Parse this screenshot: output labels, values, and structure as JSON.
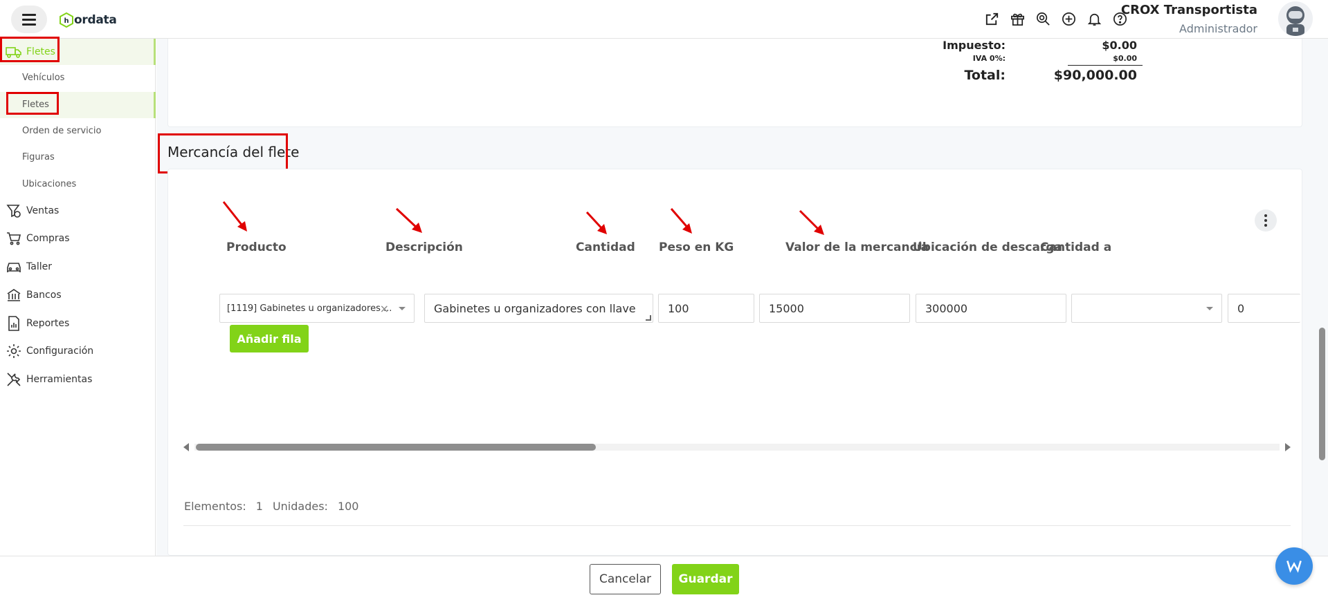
{
  "app": {
    "logo_text": "ordata",
    "logo_letter": "h"
  },
  "header": {
    "user_name": "CROX Transportista",
    "user_role": "Administrador",
    "icons": [
      "external-link-icon",
      "gift-icon",
      "search-icon",
      "plus-circle-icon",
      "bell-icon",
      "help-icon"
    ]
  },
  "sidebar": {
    "fletes_group": "Fletes",
    "sub_items": [
      "Vehículos",
      "Fletes",
      "Orden de servicio",
      "Figuras",
      "Ubicaciones"
    ],
    "items": [
      "Ventas",
      "Compras",
      "Taller",
      "Bancos",
      "Reportes",
      "Configuración",
      "Herramientas"
    ]
  },
  "totals": {
    "impuesto_label": "Impuesto:",
    "impuesto_value": "$0.00",
    "iva_label": "IVA 0%:",
    "iva_value": "$0.00",
    "total_label": "Total:",
    "total_value": "$90,000.00"
  },
  "merchandise": {
    "title": "Mercancía del flete",
    "columns": [
      "Producto",
      "Descripción",
      "Cantidad",
      "Peso en KG",
      "Valor de la mercancía",
      "Ubicación de descarga",
      "Cantidad a"
    ],
    "row": {
      "producto": "[1119] Gabinetes u organizadores ...",
      "descripcion": "Gabinetes u organizadores con llave",
      "cantidad": "100",
      "peso": "15000",
      "valor": "300000",
      "ubicacion": "",
      "cantidad_a": "0"
    },
    "add_row_label": "Añadir fila",
    "summary": {
      "elementos_label": "Elementos:",
      "elementos_value": "1",
      "unidades_label": "Unidades:",
      "unidades_value": "100"
    }
  },
  "footer": {
    "cancel_label": "Cancelar",
    "save_label": "Guardar"
  },
  "colors": {
    "brand_green": "#82d318",
    "annotation_red": "#e00000",
    "chat_blue": "#3a8ee6"
  }
}
